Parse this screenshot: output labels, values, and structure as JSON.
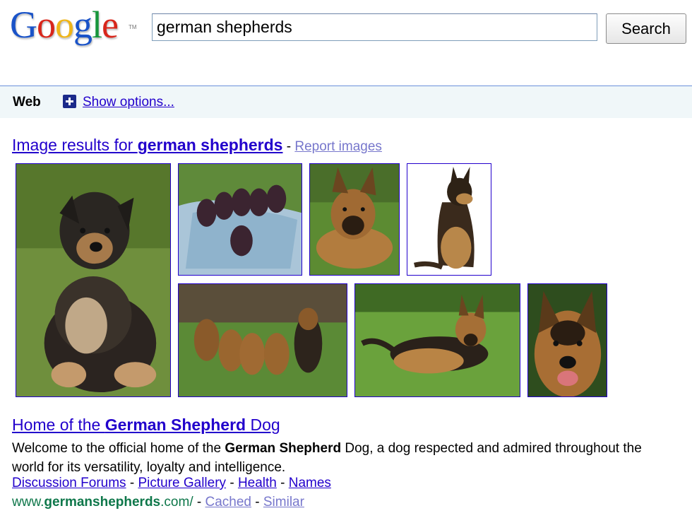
{
  "header": {
    "logo": {
      "letters": [
        "G",
        "o",
        "o",
        "g",
        "l",
        "e"
      ],
      "tm": "TM"
    },
    "search_value": "german shepherds",
    "search_button": "Search"
  },
  "options_bar": {
    "web_label": "Web",
    "show_options": "Show options..."
  },
  "image_results": {
    "heading_prefix": "Image results for ",
    "heading_query": "german shepherds",
    "separator": " - ",
    "report_link": "Report images",
    "thumbnails": [
      {
        "subject": "german-shepherd-puppy-sitting"
      },
      {
        "subject": "litter-of-puppies-on-blanket"
      },
      {
        "subject": "german-shepherd-lying-on-grass"
      },
      {
        "subject": "german-shepherd-sitting-white-background"
      },
      {
        "subject": "group-of-german-shepherds-on-lawn"
      },
      {
        "subject": "german-shepherd-lying-in-field"
      },
      {
        "subject": "german-shepherd-head-closeup"
      }
    ]
  },
  "result": {
    "title_pre": "Home of the ",
    "title_bold": "German Shepherd",
    "title_post": " Dog",
    "snippet_pre": "Welcome to the official home of the ",
    "snippet_bold": "German Shepherd",
    "snippet_post": " Dog, a dog respected and admired throughout the world for its versatility, loyalty and intelligence.",
    "sitelinks": [
      "Discussion Forums",
      "Picture Gallery",
      "Health",
      "Names"
    ],
    "sitelink_separator": " - ",
    "url_pre": "www.",
    "url_bold": "germanshepherds",
    "url_post": ".com/",
    "url_separator": " - ",
    "cached": "Cached",
    "similar": "Similar"
  },
  "colors": {
    "link": "#2200cc",
    "visited_link": "#7777cc",
    "url_green": "#0e774a",
    "options_bar_bg": "#f0f7f9",
    "options_bar_border": "#6b90da"
  }
}
